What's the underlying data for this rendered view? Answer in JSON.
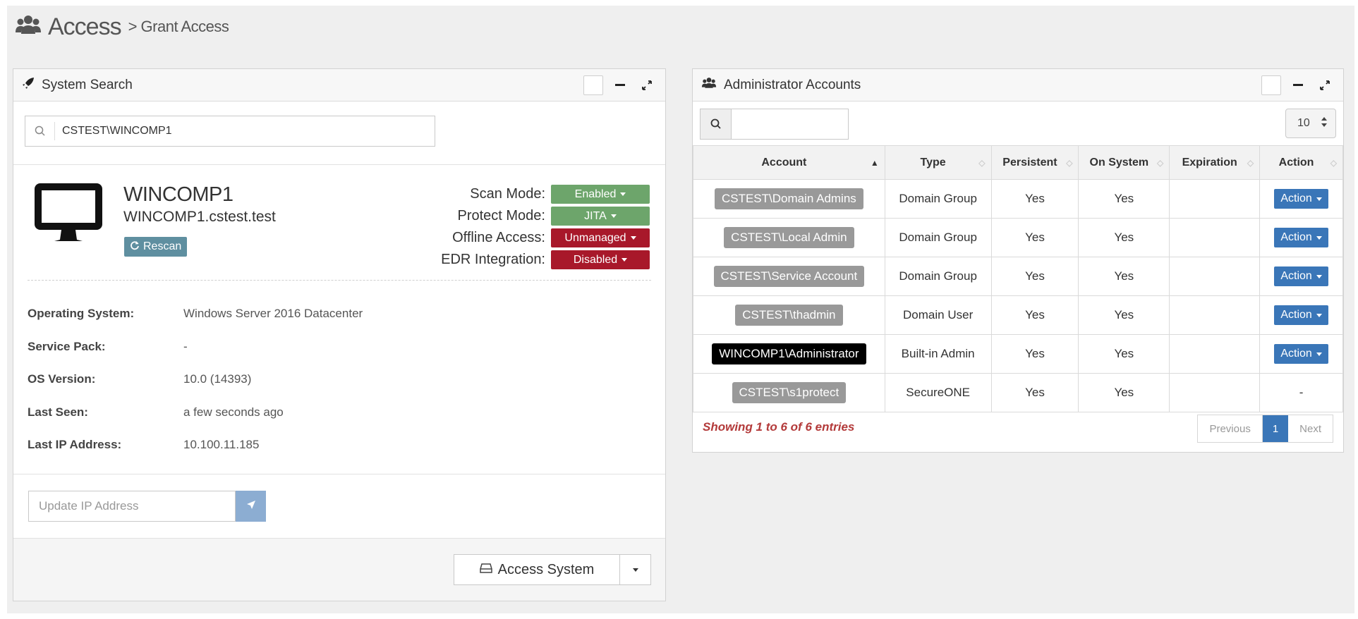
{
  "header": {
    "title": "Access",
    "subtitle": "> Grant Access"
  },
  "system_search": {
    "panel_title": "System Search",
    "search_value": "CSTEST\\WINCOMP1",
    "system_name": "WINCOMP1",
    "system_fqdn": "WINCOMP1.cstest.test",
    "rescan_label": "Rescan",
    "modes": [
      {
        "label": "Scan Mode:",
        "value": "Enabled",
        "color": "#6da56b"
      },
      {
        "label": "Protect Mode:",
        "value": "JITA",
        "color": "#6da56b"
      },
      {
        "label": "Offline Access:",
        "value": "Unmanaged",
        "color": "#a8182a"
      },
      {
        "label": "EDR Integration:",
        "value": "Disabled",
        "color": "#a8182a"
      }
    ],
    "info": [
      {
        "label": "Operating System:",
        "value": "Windows Server 2016 Datacenter"
      },
      {
        "label": "Service Pack:",
        "value": "-"
      },
      {
        "label": "OS Version:",
        "value": "10.0 (14393)"
      },
      {
        "label": "Last Seen:",
        "value": "a few seconds ago"
      },
      {
        "label": "Last IP Address:",
        "value": "10.100.11.185"
      }
    ],
    "ip_placeholder": "Update IP Address",
    "access_button": "Access System"
  },
  "admin_accounts": {
    "panel_title": "Administrator Accounts",
    "page_size": "10",
    "columns": [
      "Account",
      "Type",
      "Persistent",
      "On System",
      "Expiration",
      "Action"
    ],
    "rows": [
      {
        "account": "CSTEST\\Domain Admins",
        "type": "Domain Group",
        "persistent": "Yes",
        "on_system": "Yes",
        "expiration": "",
        "action": "Action"
      },
      {
        "account": "CSTEST\\Local Admin",
        "type": "Domain Group",
        "persistent": "Yes",
        "on_system": "Yes",
        "expiration": "",
        "action": "Action"
      },
      {
        "account": "CSTEST\\Service Account",
        "type": "Domain Group",
        "persistent": "Yes",
        "on_system": "Yes",
        "expiration": "",
        "action": "Action"
      },
      {
        "account": "CSTEST\\thadmin",
        "type": "Domain User",
        "persistent": "Yes",
        "on_system": "Yes",
        "expiration": "",
        "action": "Action"
      },
      {
        "account": "WINCOMP1\\Administrator",
        "type": "Built-in Admin",
        "persistent": "Yes",
        "on_system": "Yes",
        "expiration": "",
        "action": "Action"
      },
      {
        "account": "CSTEST\\s1protect",
        "type": "SecureONE",
        "persistent": "Yes",
        "on_system": "Yes",
        "expiration": "",
        "action": "-"
      }
    ],
    "showing_text": "Showing 1 to 6 of 6 entries",
    "pager": {
      "previous": "Previous",
      "current": "1",
      "next": "Next"
    }
  }
}
